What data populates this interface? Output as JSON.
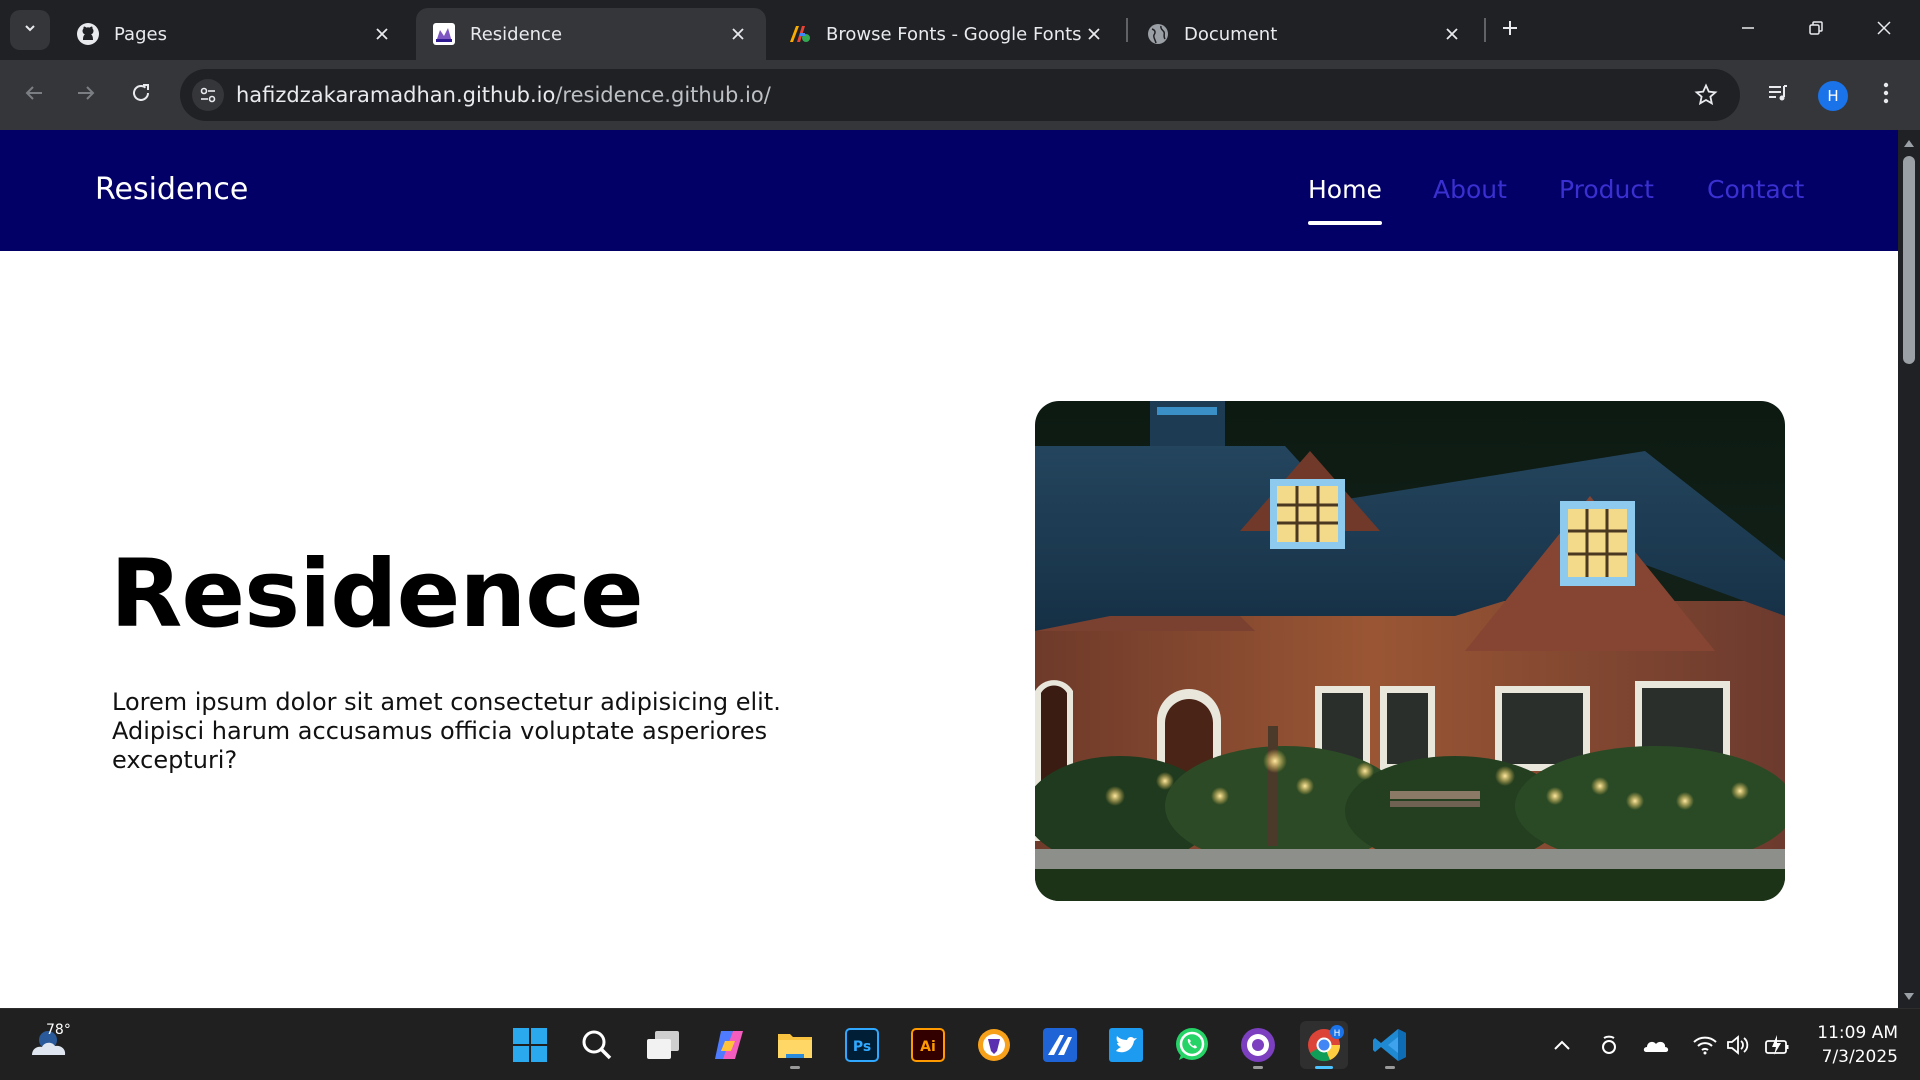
{
  "browser": {
    "tabs": [
      {
        "title": "Pages",
        "icon": "github-icon",
        "active": false
      },
      {
        "title": "Residence",
        "icon": "residence-favicon-icon",
        "active": true
      },
      {
        "title": "Browse Fonts - Google Fonts",
        "icon": "google-fonts-icon",
        "active": false
      },
      {
        "title": "Document",
        "icon": "globe-icon",
        "active": false
      }
    ],
    "url_host": "hafizdzakaramadhan.github.io",
    "url_path": "/residence.github.io/",
    "profile_initial": "H"
  },
  "site": {
    "brand": "Residence",
    "nav": [
      {
        "label": "Home",
        "active": true
      },
      {
        "label": "About",
        "active": false
      },
      {
        "label": "Product",
        "active": false
      },
      {
        "label": "Contact",
        "active": false
      }
    ],
    "hero": {
      "title": "Residence",
      "text": "Lorem ipsum dolor sit amet consectetur adipisicing elit. Adipisci harum accusamus officia voluptate asperiores excepturi?",
      "image_subject": "brick house at dusk with lit windows and garden lights"
    },
    "colors": {
      "header_bg": "#020066",
      "nav_link": "#3a2fd0",
      "nav_active": "#ffffff"
    }
  },
  "taskbar": {
    "temperature": "78°",
    "apps": [
      "start-icon",
      "search-icon",
      "task-view-icon",
      "copilot-icon",
      "file-explorer-icon",
      "photoshop-icon",
      "illustrator-icon",
      "brave-icon",
      "app-icon",
      "twitter-icon",
      "whatsapp-icon",
      "github-desktop-icon",
      "chrome-icon",
      "vscode-icon"
    ],
    "ps_label": "Ps",
    "ai_label": "Ai",
    "time": "11:09 AM",
    "date": "7/3/2025"
  }
}
